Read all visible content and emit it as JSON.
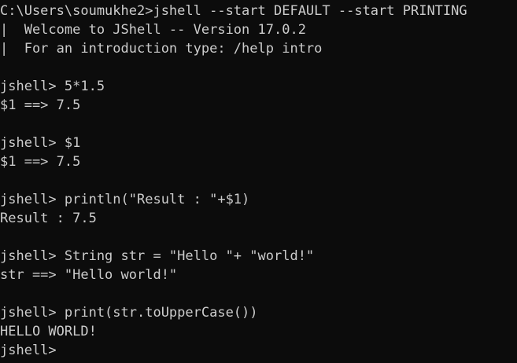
{
  "terminal": {
    "lines": [
      "C:\\Users\\soumukhe2>jshell --start DEFAULT --start PRINTING",
      "|  Welcome to JShell -- Version 17.0.2",
      "|  For an introduction type: /help intro",
      "",
      "jshell> 5*1.5",
      "$1 ==> 7.5",
      "",
      "jshell> $1",
      "$1 ==> 7.5",
      "",
      "jshell> println(\"Result : \"+$1)",
      "Result : 7.5",
      "",
      "jshell> String str = \"Hello \"+ \"world!\"",
      "str ==> \"Hello world!\"",
      "",
      "jshell> print(str.toUpperCase())",
      "HELLO WORLD!",
      "jshell>"
    ]
  },
  "colors": {
    "background": "#0c0c0c",
    "foreground": "#cccccc"
  }
}
